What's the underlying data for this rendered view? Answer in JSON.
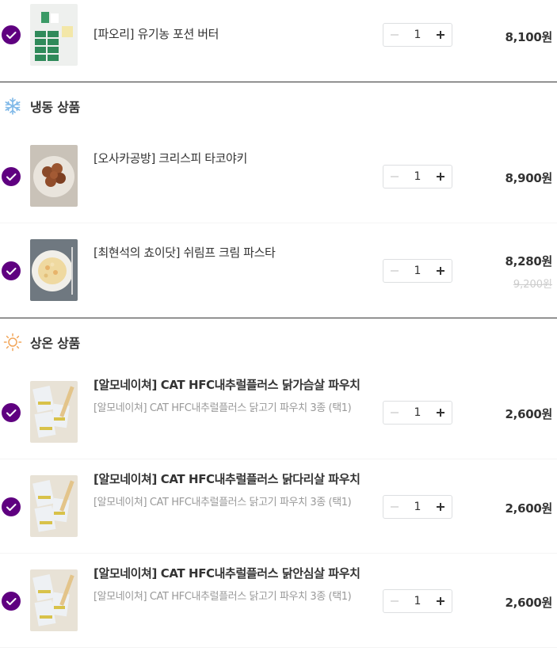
{
  "items_top": [
    {
      "name": "[파오리] 유기농 포션 버터",
      "quantity": "1",
      "price": "8,100원",
      "thumb": "butter"
    }
  ],
  "sections": [
    {
      "title": "냉동 상품",
      "icon": "snowflake-icon",
      "items": [
        {
          "name": "[오사카공방] 크리스피 타코야키",
          "quantity": "1",
          "price": "8,900원",
          "thumb": "takoyaki"
        },
        {
          "name": "[최현석의 쵸이닷] 쉬림프 크림 파스타",
          "quantity": "1",
          "price": "8,280원",
          "original_price": "9,200원",
          "thumb": "pasta"
        }
      ]
    },
    {
      "title": "상온 상품",
      "icon": "sun-icon",
      "items": [
        {
          "name": "[알모네이쳐] CAT HFC내추럴플러스 닭가슴살 파우치",
          "option": "[알모네이쳐] CAT HFC내추럴플러스 닭고기 파우치 3종 (택1)",
          "quantity": "1",
          "price": "2,600원",
          "thumb": "pouch"
        },
        {
          "name": "[알모네이쳐] CAT HFC내추럴플러스 닭다리살 파우치",
          "option": "[알모네이쳐] CAT HFC내추럴플러스 닭고기 파우치 3종 (택1)",
          "quantity": "1",
          "price": "2,600원",
          "thumb": "pouch"
        },
        {
          "name": "[알모네이쳐] CAT HFC내추럴플러스 닭안심살 파우치",
          "option": "[알모네이쳐] CAT HFC내추럴플러스 닭고기 파우치 3종 (택1)",
          "quantity": "1",
          "price": "2,600원",
          "thumb": "pouch"
        }
      ]
    }
  ],
  "colors": {
    "accent_purple": "#5f0080",
    "frozen_icon": "#7fb8e8",
    "room_temp_icon": "#f2a65a",
    "divider": "#333333",
    "muted_text": "#999999"
  }
}
